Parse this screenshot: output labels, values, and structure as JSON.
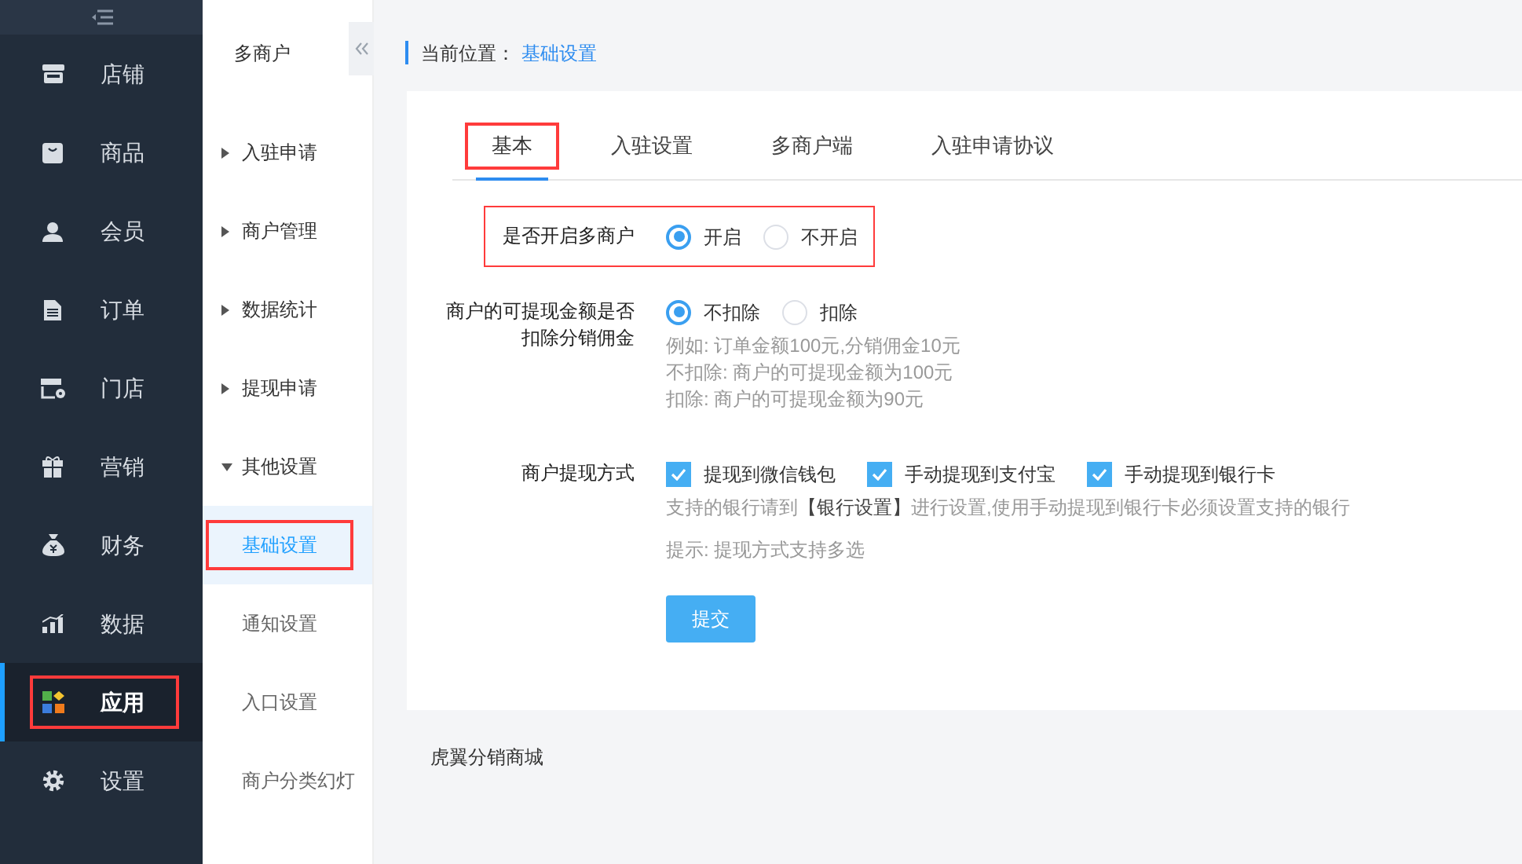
{
  "sidebar": {
    "items": [
      {
        "label": "店铺",
        "selected": false,
        "highlighted": false
      },
      {
        "label": "商品",
        "selected": false,
        "highlighted": false
      },
      {
        "label": "会员",
        "selected": false,
        "highlighted": false
      },
      {
        "label": "订单",
        "selected": false,
        "highlighted": false
      },
      {
        "label": "门店",
        "selected": false,
        "highlighted": false
      },
      {
        "label": "营销",
        "selected": false,
        "highlighted": false
      },
      {
        "label": "财务",
        "selected": false,
        "highlighted": false
      },
      {
        "label": "数据",
        "selected": false,
        "highlighted": false
      },
      {
        "label": "应用",
        "selected": true,
        "highlighted": true
      },
      {
        "label": "设置",
        "selected": false,
        "highlighted": false
      }
    ]
  },
  "submenu": {
    "title": "多商户",
    "groups": [
      {
        "label": "入驻申请",
        "expanded": false
      },
      {
        "label": "商户管理",
        "expanded": false
      },
      {
        "label": "数据统计",
        "expanded": false
      },
      {
        "label": "提现申请",
        "expanded": false
      },
      {
        "label": "其他设置",
        "expanded": true,
        "children": [
          {
            "label": "基础设置",
            "selected": true,
            "highlighted": true
          },
          {
            "label": "通知设置",
            "selected": false,
            "highlighted": false
          },
          {
            "label": "入口设置",
            "selected": false,
            "highlighted": false
          },
          {
            "label": "商户分类幻灯",
            "selected": false,
            "highlighted": false
          }
        ]
      }
    ]
  },
  "breadcrumb": {
    "label": "当前位置：",
    "current": "基础设置"
  },
  "tabs": [
    {
      "label": "基本",
      "selected": true,
      "highlighted": true
    },
    {
      "label": "入驻设置",
      "selected": false,
      "highlighted": false
    },
    {
      "label": "多商户端",
      "selected": false,
      "highlighted": false
    },
    {
      "label": "入驻申请协议",
      "selected": false,
      "highlighted": false
    }
  ],
  "settings": [
    {
      "kind": "radio",
      "label": "是否开启多商户",
      "highlighted": true,
      "options": [
        {
          "label": "开启",
          "selected": true
        },
        {
          "label": "不开启",
          "selected": false
        }
      ]
    },
    {
      "kind": "radio",
      "label": "商户的可提现金额是否扣除分销佣金",
      "highlighted": false,
      "options": [
        {
          "label": "不扣除",
          "selected": true
        },
        {
          "label": "扣除",
          "selected": false
        }
      ],
      "hints": [
        "例如: 订单金额100元,分销佣金10元",
        "不扣除: 商户的可提现金额为100元",
        "扣除: 商户的可提现金额为90元"
      ]
    },
    {
      "kind": "checkbox",
      "label": "商户提现方式",
      "highlighted": false,
      "options": [
        {
          "label": "提现到微信钱包",
          "checked": true
        },
        {
          "label": "手动提现到支付宝",
          "checked": true
        },
        {
          "label": "手动提现到银行卡",
          "checked": true
        }
      ],
      "hints": [
        "支持的银行请到**【银行设置】**进行设置,使用手动提现到银行卡必须设置支持的银行",
        "提示: 提现方式支持多选"
      ]
    }
  ],
  "submit_button": "提交",
  "footer": "虎翼分销商城"
}
